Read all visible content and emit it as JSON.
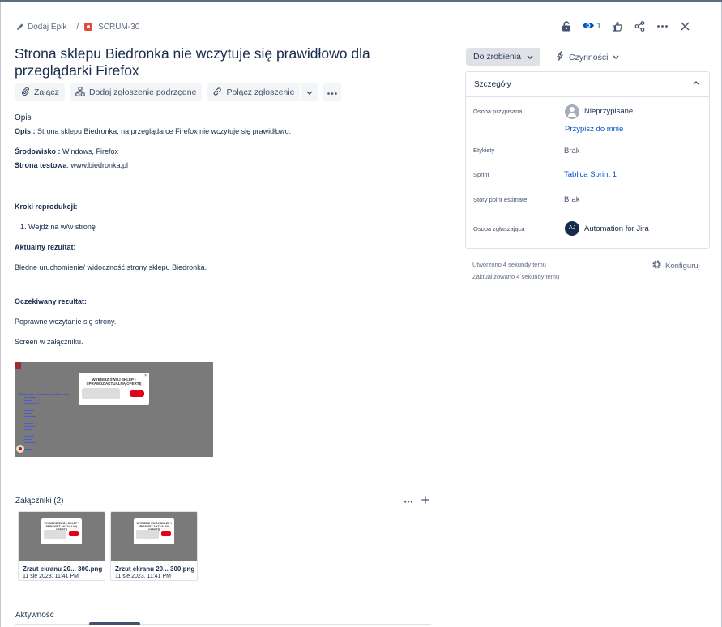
{
  "breadcrumb": {
    "epic_label": "Dodaj Epik",
    "separator": "/",
    "issue_key": "SCRUM-30"
  },
  "header": {
    "watch_count": "1"
  },
  "issue": {
    "title": "Strona sklepu Biedronka nie wczytuje się prawidłowo dla przeglądarki Firefox"
  },
  "actions": {
    "attach": "Załącz",
    "add_child": "Dodaj zgłoszenie podrzędne",
    "link_issue": "Połącz zgłoszenie"
  },
  "description": {
    "heading": "Opis",
    "opis_label": "Opis :",
    "opis_text": " Strona sklepu Biedronka, na przeglądarce Firefox nie wczytuje się prawidłowo.",
    "env_label": "Środowisko :",
    "env_text": " Windows, Firefox",
    "test_label": "Strona testowa",
    "test_text": ": www.biedronka.pl",
    "steps_heading": "Kroki reprodukcji:",
    "steps": [
      "1. Wejdź na w/w stronę"
    ],
    "actual_heading": "Aktualny rezultat:",
    "actual_text": "Błędne uruchomienie/ widoczność strony sklepu Biedronka.",
    "expected_heading": "Oczekiwany rezultat:",
    "expected_text": "Poprawne wczytanie się strony.",
    "screen_note": "Screen w załączniku."
  },
  "screenshot_preview": {
    "modal_title": "WYBIERZ SWÓJ SKLEP I SPRAWDŹ AKTUALNĄ OFERTĘ",
    "close_glyph": "×",
    "link_text": "Biedronka - Codziennie niskie ceny"
  },
  "attachments": {
    "heading": "Załączniki (2)",
    "items": [
      {
        "name": "Zrzut ekranu 20... 300.png",
        "date": "11 sie 2023, 11:41 PM",
        "thumb_title": "WYBIERZ SWÓJ SKLEP I SPRAWDŹ AKTUALNĄ OFERTĘ"
      },
      {
        "name": "Zrzut ekranu 20... 300.png",
        "date": "11 sie 2023, 11:41 PM",
        "thumb_title": "WYBIERZ SWÓJ SKLEP I SPRAWDŹ AKTUALNĄ OFERTĘ"
      }
    ]
  },
  "activity": {
    "heading": "Aktywność"
  },
  "sidebar": {
    "status": "Do zrobienia",
    "actions_label": "Czynności",
    "details_title": "Szczegóły",
    "fields": {
      "assignee_label": "Osoba przypisana",
      "assignee_value": "Nieprzypisane",
      "assign_me": "Przypisz do mnie",
      "labels_label": "Etykiety",
      "labels_value": "Brak",
      "sprint_label": "Sprint",
      "sprint_value": "Tablica Sprint 1",
      "sp_label": "Story point estimate",
      "sp_value": "Brak",
      "reporter_label": "Osoba zgłaszająca",
      "reporter_initials": "AJ",
      "reporter_value": "Automation for Jira"
    },
    "created": "Utworzono 4 sekundy temu",
    "updated": "Zaktualizowano 4 sekundy temu",
    "configure": "Konfiguruj"
  },
  "icons": {
    "breadcrumb_epic": "pencil-icon",
    "issue_type": "bug-icon",
    "lock": "lock-icon",
    "watch": "eye-icon",
    "like": "thumbs-up-icon",
    "share": "share-icon",
    "more": "ellipsis-icon",
    "close": "close-icon",
    "attach": "paperclip-icon",
    "child": "hierarchy-icon",
    "link": "link-icon",
    "lightning": "lightning-icon",
    "gear": "gear-icon",
    "collapse": "chevron-up-icon"
  },
  "colors": {
    "link": "#0052cc",
    "status_bg": "#dfe1e6",
    "bug": "#e5493a",
    "brand_red": "#e2001a"
  }
}
